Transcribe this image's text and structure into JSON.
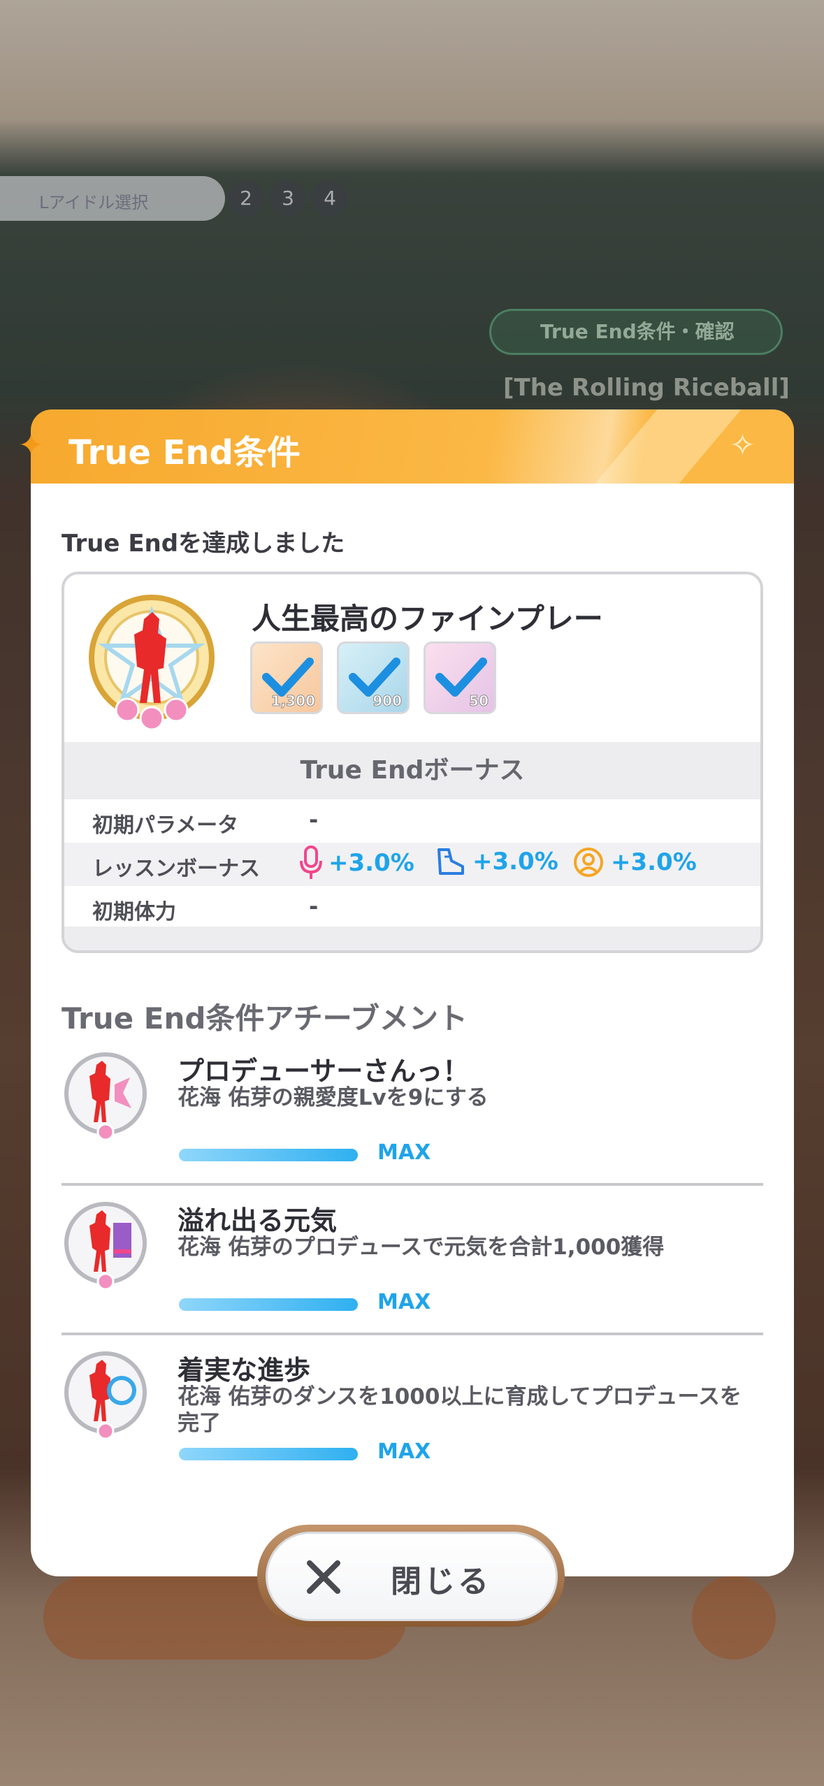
{
  "background": {
    "pill_text": "Lアイドル選択",
    "numbers": [
      "2",
      "3",
      "4"
    ],
    "true_end_pill": "True End条件・確認",
    "song_title": "[The Rolling Riceball]"
  },
  "modal": {
    "title": "True End条件",
    "subtitle": "True Endを達成しました",
    "card": {
      "name": "人生最高のファインプレー",
      "items": [
        {
          "icon": "vocal-item-icon",
          "qty": "1,300",
          "checked": true
        },
        {
          "icon": "dance-item-icon",
          "qty": "900",
          "checked": true
        },
        {
          "icon": "visual-item-icon",
          "qty": "50",
          "checked": true
        }
      ],
      "bonus_header": "True Endボーナス",
      "rows": [
        {
          "label": "初期パラメータ",
          "value": "-"
        },
        {
          "label": "レッスンボーナス",
          "bonuses": [
            {
              "icon": "vocal-mic-icon",
              "value": "+3.0%"
            },
            {
              "icon": "dance-shoe-icon",
              "value": "+3.0%"
            },
            {
              "icon": "visual-icon",
              "value": "+3.0%"
            }
          ]
        },
        {
          "label": "初期体力",
          "value": "-"
        }
      ]
    },
    "achievements_title": "True End条件アチーブメント",
    "achievements": [
      {
        "name": "プロデューサーさんっ！",
        "desc": "花海 佑芽の親愛度Lvを9にする",
        "progress": 1.0,
        "status": "MAX"
      },
      {
        "name": "溢れ出る元気",
        "desc": "花海 佑芽のプロデュースで元気を合計1,000獲得",
        "progress": 1.0,
        "status": "MAX"
      },
      {
        "name": "着実な進歩",
        "desc": "花海 佑芽のダンスを1000以上に育成してプロデュースを完了",
        "progress": 1.0,
        "status": "MAX"
      }
    ],
    "close_label": "閉じる"
  },
  "colors": {
    "accent": "#1fa4ea",
    "header": "#f7a92e"
  }
}
